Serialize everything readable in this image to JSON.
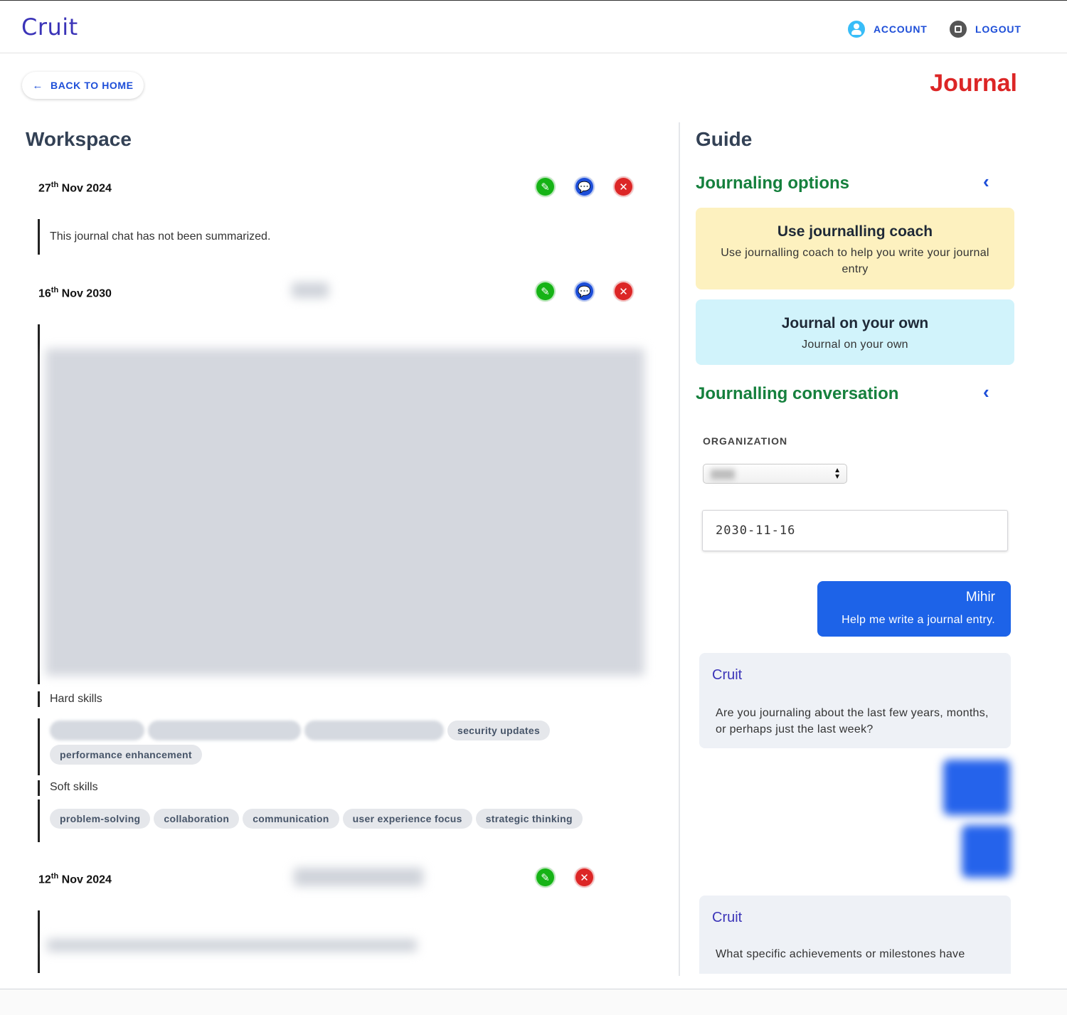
{
  "header": {
    "logo": "Cruit",
    "account_label": "ACCOUNT",
    "logout_label": "LOGOUT",
    "account_icon": "user-circle-icon",
    "logout_icon": "stop-icon"
  },
  "page": {
    "back_label": "BACK TO HOME",
    "title": "Journal"
  },
  "workspace": {
    "title": "Workspace",
    "entries": [
      {
        "day": "27",
        "suffix": "th",
        "rest": " Nov 2024",
        "summary": "This journal chat has not been summarized."
      },
      {
        "day": "16",
        "suffix": "th",
        "rest": " Nov 2030",
        "hard_skills_label": "Hard skills",
        "hard_skills": [
          "security updates",
          "performance enhancement"
        ],
        "soft_skills_label": "Soft skills",
        "soft_skills": [
          "problem-solving",
          "collaboration",
          "communication",
          "user experience focus",
          "strategic thinking"
        ]
      },
      {
        "day": "12",
        "suffix": "th",
        "rest": " Nov 2024"
      }
    ]
  },
  "guide": {
    "title": "Guide",
    "options_heading": "Journaling options",
    "options": [
      {
        "title": "Use journalling coach",
        "desc": "Use journalling coach to help you write your journal entry",
        "color": "#fdf1bf"
      },
      {
        "title": "Journal on your own",
        "desc": "Journal on your own",
        "color": "#d1f3fb"
      }
    ],
    "conversation_heading": "Journalling conversation",
    "organization_label": "ORGANIZATION",
    "date_value": "2030-11-16",
    "messages": [
      {
        "sender": "Mihir",
        "text": "Help me write a journal entry."
      },
      {
        "sender": "Cruit",
        "text": "Are you journaling about the last few years, months, or perhaps just the last week?"
      },
      {
        "sender": "Cruit",
        "text": "What specific achievements or milestones have"
      }
    ]
  },
  "colors": {
    "brand": "#3b34b8",
    "accent": "#1d4ed8",
    "title_red": "#dc2626",
    "heading_green": "#15803d"
  }
}
